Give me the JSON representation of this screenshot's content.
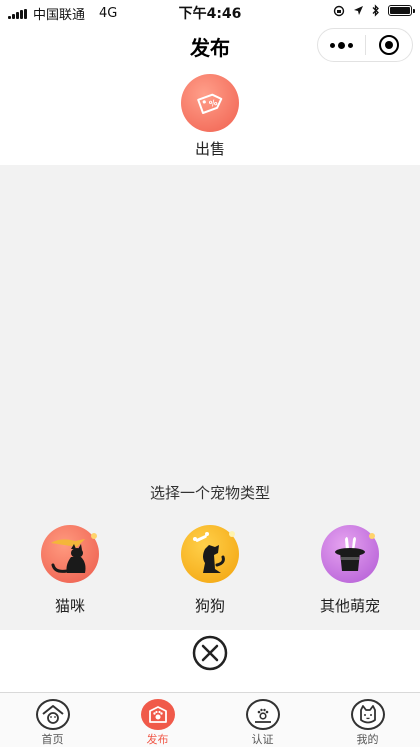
{
  "status_bar": {
    "carrier": "中国联通",
    "network": "4G",
    "time": "下午4:46"
  },
  "nav": {
    "title": "发布"
  },
  "publish_action": {
    "label": "出售",
    "icon": "price-tag-icon",
    "color": "#f0604f"
  },
  "pet_selector": {
    "prompt": "选择一个宠物类型",
    "options": [
      {
        "label": "猫咪",
        "icon": "cat-icon",
        "color": "#f06f5f"
      },
      {
        "label": "狗狗",
        "icon": "dog-icon",
        "color": "#f7b514"
      },
      {
        "label": "其他萌宠",
        "icon": "magic-hat-rabbit-icon",
        "color": "#b562d8"
      }
    ]
  },
  "close": {
    "icon": "close-circle-icon"
  },
  "tab_bar": {
    "items": [
      {
        "label": "首页",
        "icon": "home-dog-icon",
        "active": false
      },
      {
        "label": "发布",
        "icon": "publish-paw-icon",
        "active": true
      },
      {
        "label": "认证",
        "icon": "certify-paw-icon",
        "active": false
      },
      {
        "label": "我的",
        "icon": "profile-cat-icon",
        "active": false
      }
    ],
    "active_color": "#f05a4a"
  }
}
